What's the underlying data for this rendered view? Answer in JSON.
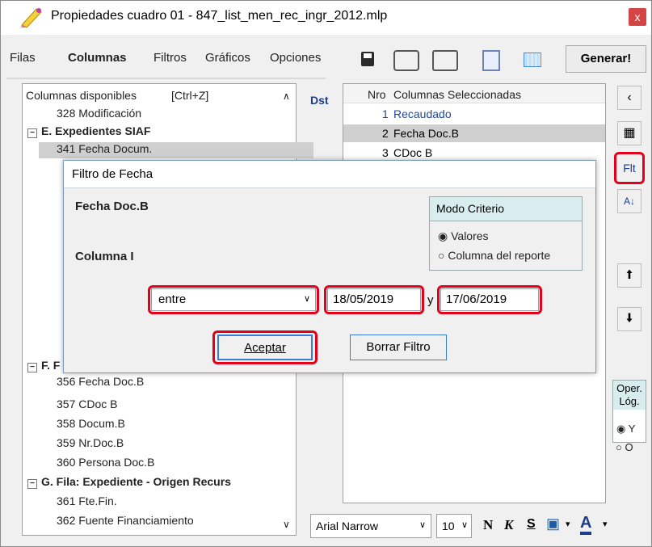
{
  "window": {
    "title": "Propiedades cuadro 01 - 847_list_men_rec_ingr_2012.mlp",
    "close": "x"
  },
  "tabs": [
    "Filas",
    "Columnas",
    "Filtros",
    "Gráficos",
    "Opciones"
  ],
  "toolbar": {
    "generate_label": "Generar!"
  },
  "left_panel": {
    "header": "Columnas disponibles",
    "shortcut": "[Ctrl+Z]",
    "items": [
      "328 Modificación",
      "E. Expedientes SIAF",
      "341 Fecha Docum.",
      "F. F",
      "356 Fecha Doc.B",
      "357 CDoc B",
      "358 Docum.B",
      "359 Nr.Doc.B",
      "360 Persona Doc.B",
      "G. Fila: Expediente - Origen Recurs",
      "361 Fte.Fin.",
      "362 Fuente Financiamiento"
    ]
  },
  "mid": {
    "dst_label": "Dst"
  },
  "right_panel": {
    "header_nro": "Nro",
    "header_title": "Columnas Seleccionadas",
    "rows": [
      {
        "nro": "1",
        "name": "Recaudado"
      },
      {
        "nro": "2",
        "name": "Fecha Doc.B"
      },
      {
        "nro": "3",
        "name": "CDoc B"
      }
    ]
  },
  "side": {
    "flt_label": "Flt",
    "oper_label": "Oper. Lóg.",
    "opt_y": "Y",
    "opt_o": "O"
  },
  "dialog": {
    "title": "Filtro de Fecha",
    "field_name": "Fecha Doc.B",
    "column_label": "Columna I",
    "mode_title": "Modo Criterio",
    "mode_opt1": "Valores",
    "mode_opt2": "Columna del reporte",
    "operator": "entre",
    "date_from": "18/05/2019",
    "and_label": "y",
    "date_to": "17/06/2019",
    "accept": "Aceptar",
    "clear": "Borrar Filtro"
  },
  "format_bar": {
    "font": "Arial Narrow",
    "size": "10",
    "bold": "N",
    "italic": "K",
    "strike": "S",
    "font_color": "A"
  }
}
